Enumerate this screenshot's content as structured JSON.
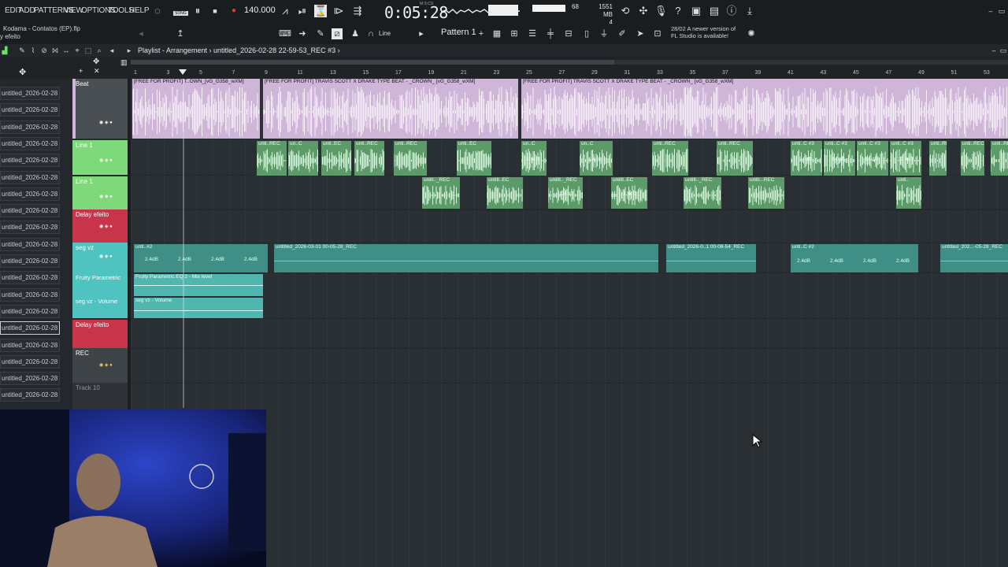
{
  "menu": [
    "EDIT",
    "ADD",
    "PATTERNS",
    "VIEW",
    "OPTIONS",
    "TOOLS",
    "HELP"
  ],
  "transport": {
    "song_mode": "SONG",
    "tempo": "140.000",
    "time": "0:05:28",
    "time_label": "M:S:CS",
    "cpu": "68",
    "memory": "1551 MB",
    "polyphony": "4"
  },
  "project": {
    "line1": "Kodama - Contatos (EP).flp",
    "line2": "y efeito"
  },
  "toolbar2": {
    "snap": "Line",
    "pattern": "Pattern 1",
    "news_line1": "28/02  A newer version of",
    "news_line2": "FL Studio is available!"
  },
  "playlist": {
    "title": "Playlist - Arrangement",
    "breadcrumb": "untitled_2026-02-28 22-59-53_REC #3"
  },
  "ruler_ticks": [
    "1",
    "3",
    "5",
    "7",
    "9",
    "11",
    "13",
    "15",
    "17",
    "19",
    "21",
    "23",
    "25",
    "27",
    "29",
    "31",
    "33",
    "35",
    "37",
    "39",
    "41",
    "43",
    "45",
    "47",
    "49",
    "51",
    "53"
  ],
  "browser_items": [
    "untitled_2026-02-28 22-...",
    "untitled_2026-02-28 22-...",
    "untitled_2026-02-28 22-...",
    "untitled_2026-02-28 22-...",
    "untitled_2026-02-28 22-...",
    "untitled_2026-02-28 22-...",
    "untitled_2026-02-28 22-...",
    "untitled_2026-02-28 22-...",
    "untitled_2026-02-28 22-...",
    "untitled_2026-02-28 22-...",
    "untitled_2026-02-28 22-...",
    "untitled_2026-02-28 22-...",
    "untitled_2026-02-28 22-...",
    "untitled_2026-02-28 22-...",
    "untitled_2026-02-28 22-...",
    "untitled_2026-02-28 23-...",
    "untitled_2026-02-28 23-...",
    "untitled_2026-02-28 23-...",
    "untitled_2026-02-28 23-..."
  ],
  "tracks": {
    "beat": "Beat",
    "line1": "Line 1",
    "line1b": "Line 1",
    "delay1": "Delay efeito",
    "segvz": "seg vz",
    "fruity": "Fruity Parametric",
    "segvol": "seg vz - Volume",
    "delay2": "Delay efeito",
    "rec": "REC",
    "track10": "Track 10"
  },
  "clips": {
    "beat1": "[FREE FOR PROFIT] T..OWN_[vG_G358_wXM]",
    "beat2": "[FREE FOR PROFIT] TRAVIS SCOTT X DRAKE TYPE BEAT - _CROWN_ [vG_G358_wXM]",
    "beat3": "[FREE FOR PROFIT] TRAVIS SCOTT X DRAKE TYPE BEAT - _CROWN_ [vG_G358_wXM]",
    "line_short": "unti..REC",
    "line_hash": "unti..C #2",
    "line_a": "un..C",
    "line_b": "unti..EC",
    "line_c": "unti..C #3",
    "line2_a": "untit.._REC",
    "line2_b": "untitl..EC",
    "line2_c": "untitl.._REC",
    "line2_d": "untitl.._REC",
    "line2_e": "untit...REC",
    "line2_f": "untitl...EC",
    "line2_g": "unti..",
    "seg_long": "untitled_2026-03-01 00-05-28_REC",
    "seg_mid": "untitled_2026-0..1 00-08-54_REC",
    "seg_end": "untitled_202...-05-28_REC",
    "seg_short": "unti..#2",
    "seg_short2": "unti..C #2",
    "auto_eq": "Fruity Parametric EQ 2 - Mix level",
    "auto_vol": "seg vz - Volume"
  },
  "gains": {
    "g1": "1.4dB",
    "g2": "-1.4dB",
    "g3": "6.0dB",
    "g4": "12.4dB",
    "g5": "2.4dB"
  },
  "colors": {
    "beat_clip": "#cfb6d8",
    "line_clip": "#5c9a6a",
    "line_header": "#7ed97a",
    "delay_header": "#c8344a",
    "seg_header": "#4fc3c0",
    "seg_clip": "#3f8f86"
  }
}
